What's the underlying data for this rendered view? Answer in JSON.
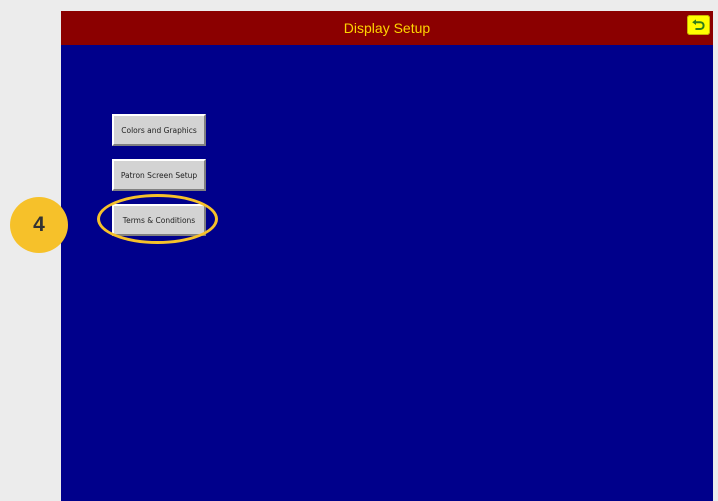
{
  "header": {
    "title": "Display Setup",
    "back_icon": "return-arrow-icon"
  },
  "menu": {
    "colors_label": "Colors and Graphics",
    "patron_label": "Patron Screen Setup",
    "terms_label": "Terms & Conditions"
  },
  "annotation": {
    "step_number": "4"
  },
  "colors": {
    "title_bar": "#8b0000",
    "title_text": "#ffd400",
    "screen_background": "#00008b",
    "button_face": "#d3d3d3",
    "highlight": "#f6c12a",
    "back_button": "#ffff00"
  }
}
